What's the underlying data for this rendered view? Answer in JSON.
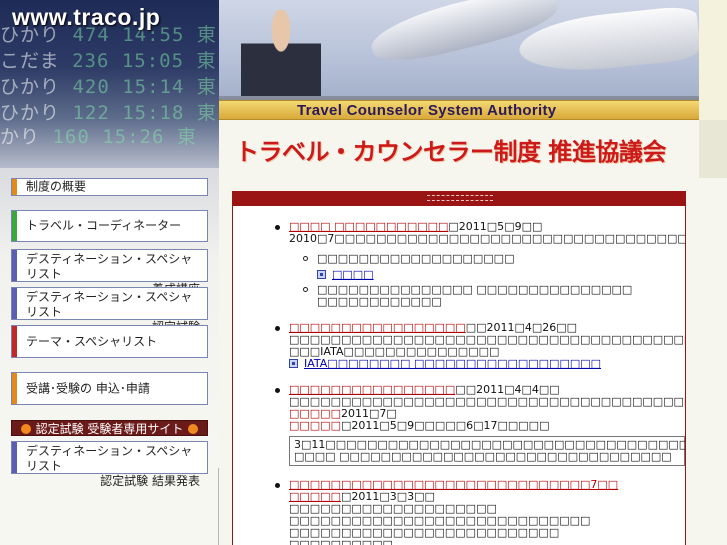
{
  "header": {
    "site_url": "www.traco.jp",
    "ribbon_text": "Travel Counselor System Authority",
    "main_title": "トラベル・カウンセラー制度 推進協議会",
    "ticker_lines": [
      {
        "a": "ひかり",
        "b": "474  14:55 東"
      },
      {
        "a": "こだま",
        "b": "236  15:05 東"
      },
      {
        "a": "ひかり",
        "b": "420  15:14 東"
      },
      {
        "a": "ひかり",
        "b": "122  15:18 東"
      },
      {
        "a": "かり",
        "b": "160  15:26 東"
      }
    ]
  },
  "sidebar": {
    "items": [
      {
        "line1": "制度の概要",
        "line2": "",
        "color": "#e38a1c"
      },
      {
        "line1": "トラベル・コーディネーター",
        "line2": "",
        "color": "#3aa83a"
      },
      {
        "line1": "デスティネーション・スペシャリスト",
        "line2": "養成講座",
        "color": "#5a5fb3"
      },
      {
        "line1": "デスティネーション・スペシャリスト",
        "line2": "認定試験",
        "color": "#5a5fb3"
      },
      {
        "line1": "テーマ・スペシャリスト",
        "line2": "",
        "color": "#c0282a"
      },
      {
        "line1": "受講･受験の 申込･申請",
        "line2": "",
        "color": "#e38a1c"
      }
    ],
    "exam_site_label": "認定試験 受験者専用サイト",
    "result_item": {
      "line1": "デスティネーション・スペシャリスト",
      "line2": "認定試験 結果発表",
      "color": "#5a5fb3"
    }
  },
  "news": {
    "header_label": "",
    "items": [
      {
        "title": "□□□□ □□□□□□□□□□□",
        "date": "□2011□5□9□□",
        "body": "2010□7□□□□□□□□□□□□□□□□□□□□□□□□□□□□□□□□□□□□□□□□□□□□□□□□□□□□□",
        "body_link": "□□□□□□□□□□□",
        "body_tail": "□",
        "subs": [
          {
            "text": "□□□□□□□□□□□□□□□□□□□",
            "link": "□□□□"
          },
          {
            "text": "□□□□□□□□□□□□□□□ □□□□□□□□□□□□□□□ □□□□□□□□□□□□",
            "link": ""
          }
        ]
      },
      {
        "title": "□□□□□□□□□□□□□□□□□",
        "date": "□□2011□4□26□□",
        "body": "□□□□□□□□□□□□□□□□□□□□□□□□□□□□□□□□□□□□□□□□□□□□□□□□□□□□□□□□□□□□□□□□□□□□□□□□",
        "body2": "□□□IATA□□□□□□□□□□□□□□□",
        "link": "IATA□□□□□□□□ □□□□□□□□□□□□□□□□□□"
      },
      {
        "title": "□□□□□□□□□□□□□□□□",
        "date": "□□2011□4□4□□",
        "body": "□□□□□□□□□□□□□□□□□□□□□□□□□□□□□□□□□□□□□□□□□□□□□□□□□□□□□□□□□□□□□□□□□□□□□□□□□□□□□□□□□□□□□□□□□□",
        "red1": "□□□□□",
        "red1_tail": "2011□7□",
        "red2": "□□□□□",
        "red2_tail": "□2011□5□9□□□□□6□17□□□□□",
        "notice": "3□11□□□□□□□□□□□□□□□□□□□□□□□□□□□□□□□□□□□□□□□□□□□□□□□□□□□□□□□□□ □□□□ □□□□□□□□□□□□□□□□□□□□□□□□□□□□□□□□"
      },
      {
        "title": "□□□□□□□□□□□□□□□□□□□□□□□□□□□□□7□□ □□□□□",
        "date": "□2011□3□3□□",
        "body": "□□□□□□□□□□□□□□□□□□□□ □□□□□□□□□□□□□□□□□□□□□□□□□□□□□ □□□□□□□□□□□□□□□□□□□□□□□□□□",
        "body2": "□□□□□□□□□□",
        "link": "□□□□□□□□□□□□□□□□□□□□□□□ □□□□"
      }
    ]
  },
  "colors": {
    "accent_red": "#9b1414",
    "title_red": "#cc1a1a",
    "link_blue": "#0000aa"
  }
}
